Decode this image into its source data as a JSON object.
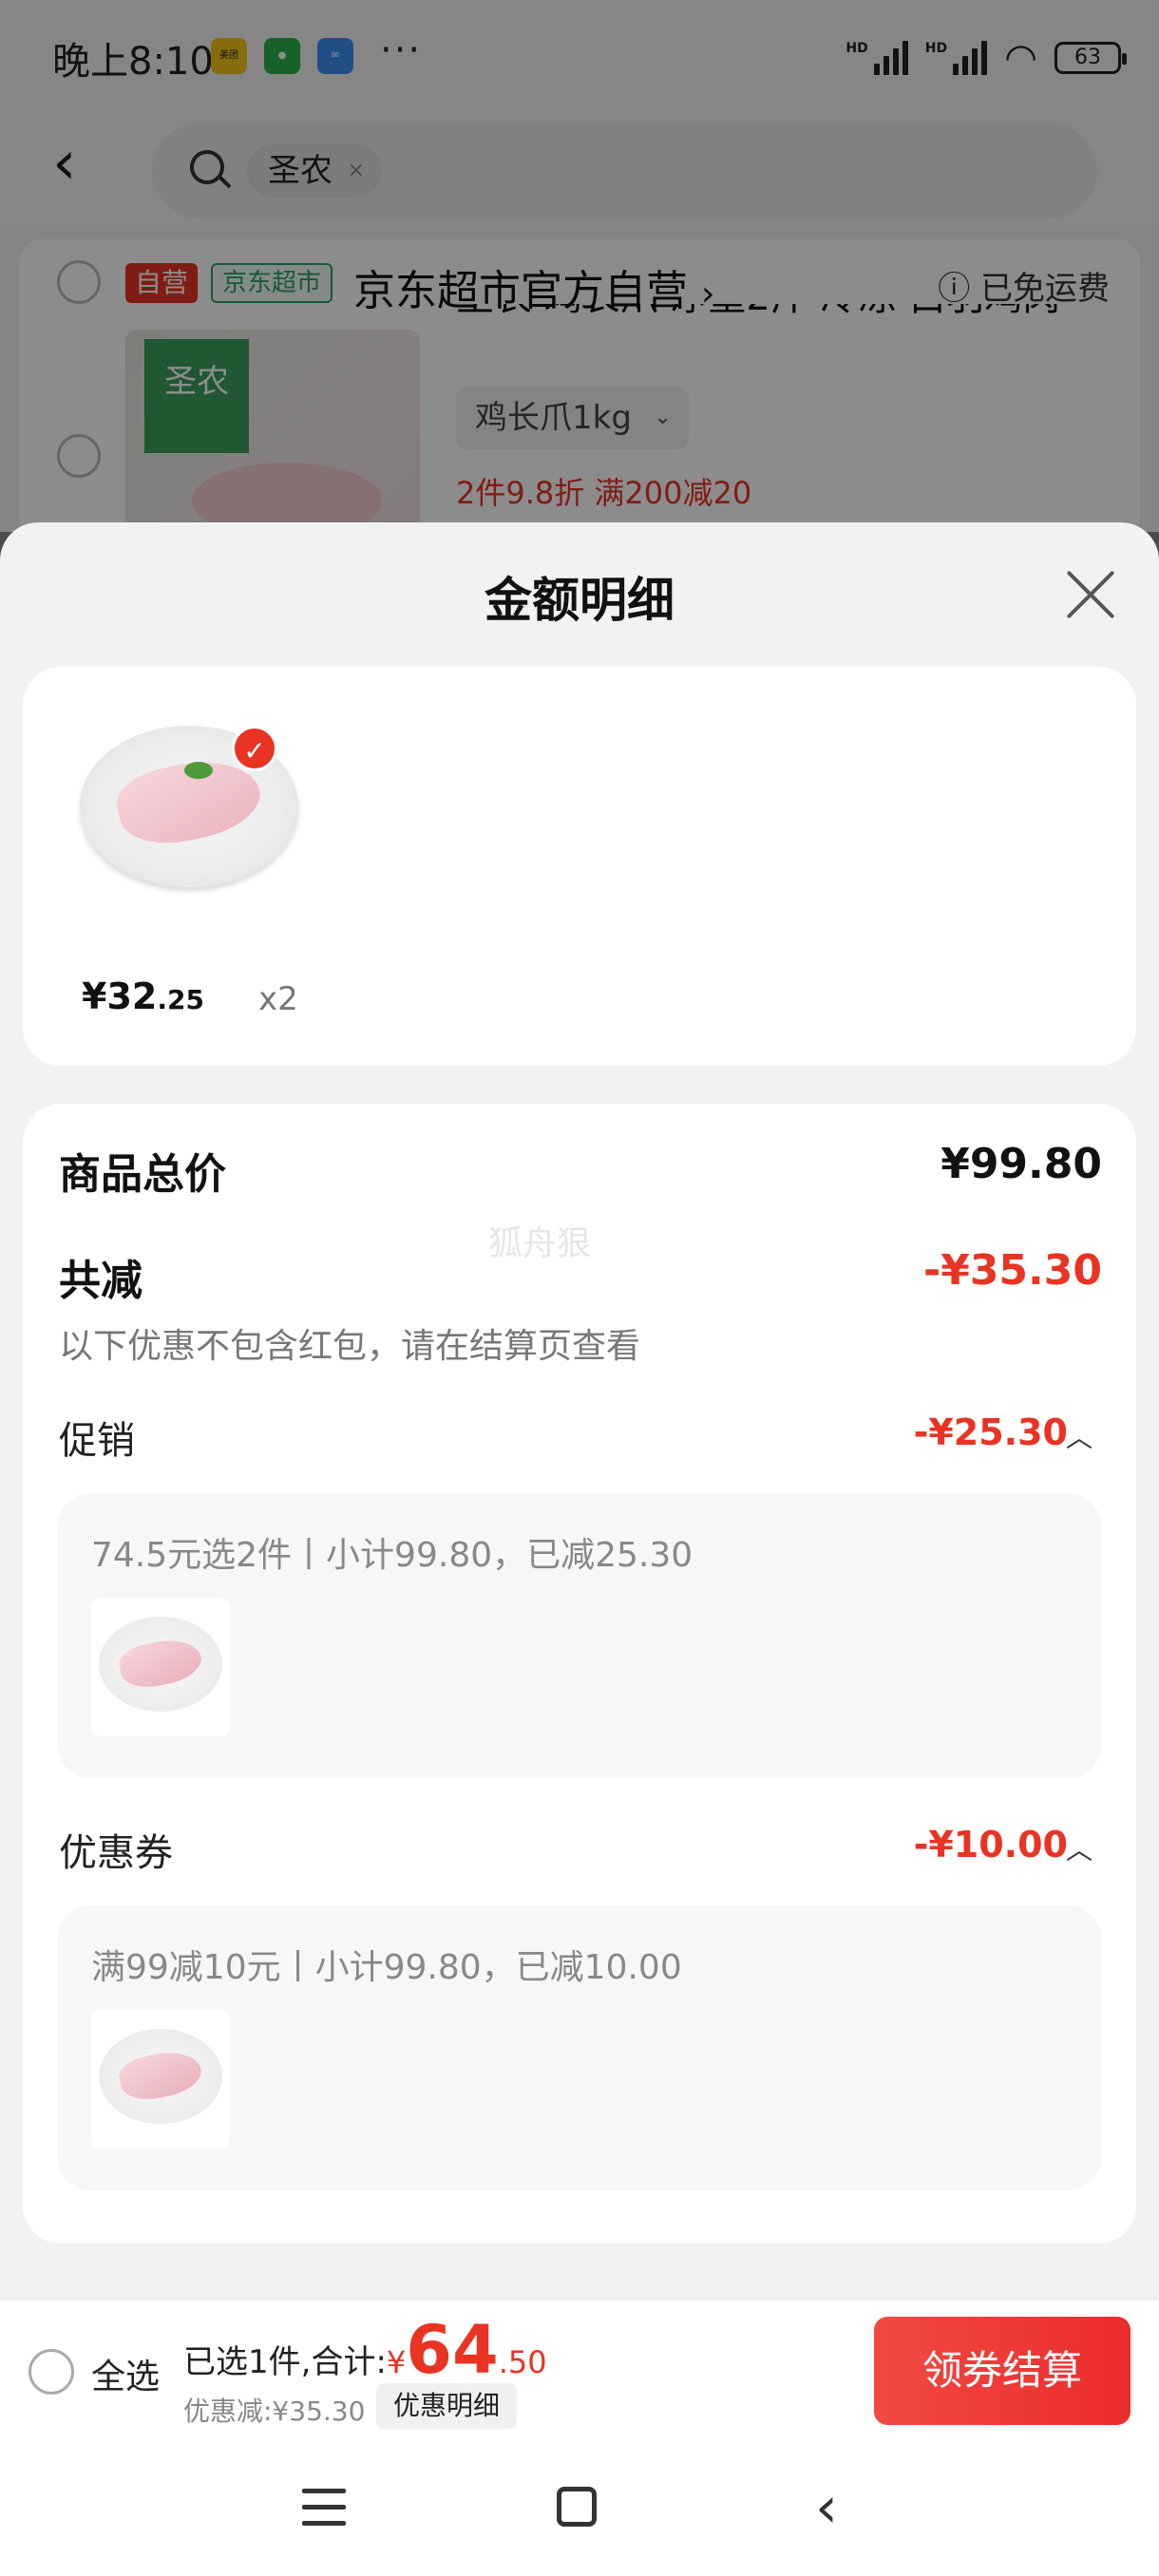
{
  "status_bar": {
    "time": "晚上8:10",
    "dots": "···",
    "battery": "63",
    "app_icons": [
      {
        "name": "meituan-icon",
        "label": "美团",
        "color": "#f5c518"
      },
      {
        "name": "wechat-icon",
        "label": "",
        "color": "#2bb24c"
      },
      {
        "name": "mail-icon",
        "label": "",
        "color": "#3a8ef6"
      }
    ]
  },
  "search": {
    "query_chip": "圣农",
    "chip_close": "×"
  },
  "store": {
    "tag_self": "自营",
    "tag_jd": "京东超市",
    "name": "京东超市官方自营",
    "name_arrow": "›",
    "shipping": "ⓘ 已免运费",
    "product_title": "圣农 鸡长爪 净重2斤 冷冻 白羽鸡肉",
    "product_brand": "圣农",
    "spec": "鸡长爪1kg",
    "spec_arrow": "⌄",
    "promo": "2件9.8折  满200减20"
  },
  "sheet": {
    "title": "金额明细",
    "item": {
      "price_yuan": "¥32",
      "price_cents": ".25",
      "qty": "x2",
      "badge": "✓"
    },
    "total_label": "商品总价",
    "total_value": "¥99.80",
    "reduce_label": "共减",
    "reduce_value": "-¥35.30",
    "reduce_note": "以下优惠不包含红包，请在结算页查看",
    "watermark": "狐舟狠",
    "promo_section": {
      "label": "促销",
      "value": "-¥25.30",
      "caret": "︿",
      "detail": "74.5元选2件丨小计99.80，已减25.30"
    },
    "coupon_section": {
      "label": "优惠券",
      "value": "-¥10.00",
      "caret": "︿",
      "detail": "满99减10元丨小计99.80，已减10.00"
    }
  },
  "checkout": {
    "select_all": "全选",
    "total_prefix": "已选1件,合计:",
    "currency": "¥",
    "total_int": "64",
    "total_dec": ".50",
    "discount": "优惠减:¥35.30",
    "detail_button": "优惠明细",
    "pay_button": "领券结算"
  },
  "colors": {
    "accent_red": "#e93323",
    "jd_green": "#2aa36c"
  }
}
